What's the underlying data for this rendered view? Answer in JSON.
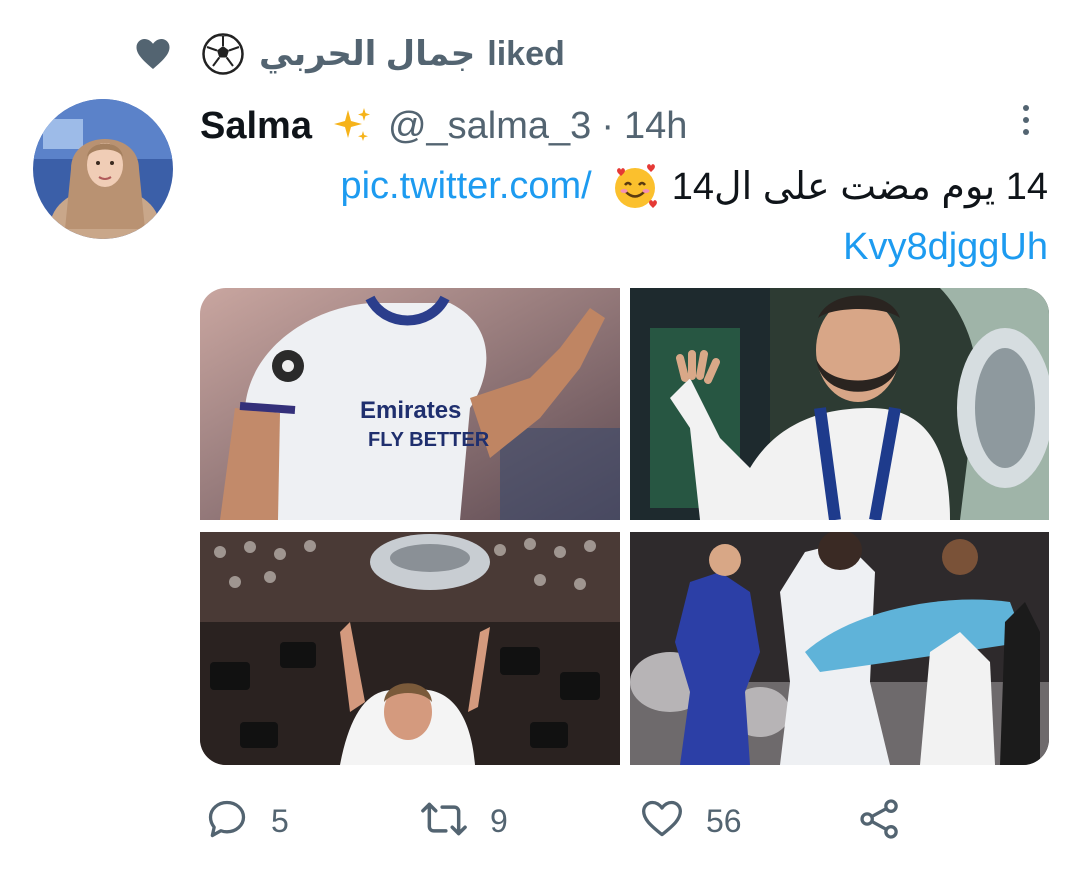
{
  "social_context": {
    "liker_name": "جمال الحربي",
    "liked_label": "liked",
    "icon": "heart-icon",
    "liker_emoji": "soccer-ball-icon"
  },
  "tweet": {
    "display_name": "Salma",
    "name_emoji": "sparkles-icon",
    "handle": "@_salma_3",
    "separator": "·",
    "time": "14h",
    "text_arabic": "14 يوم مضت على ال14",
    "text_emoji": "smiling-face-with-hearts-icon",
    "link_part1": "pic.twitter.com/",
    "link_part2": "Kvy8djggUh",
    "images": [
      "player-in-white-jersey-waving",
      "bearded-player-with-trophy",
      "player-lifting-trophy-in-crowd",
      "players-celebrating-with-children"
    ]
  },
  "actions": {
    "reply_count": "5",
    "retweet_count": "9",
    "like_count": "56",
    "icons": [
      "reply-icon",
      "retweet-icon",
      "like-icon",
      "share-icon"
    ]
  },
  "colors": {
    "text_primary": "#0f1419",
    "text_secondary": "#536471",
    "link": "#1d9bf0",
    "background": "#ffffff"
  }
}
